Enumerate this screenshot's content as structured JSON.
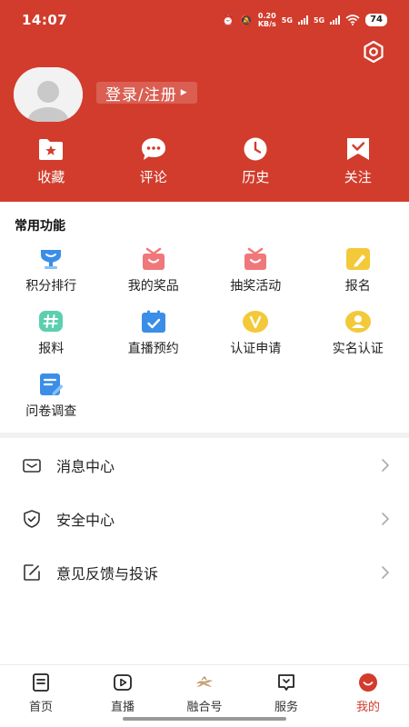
{
  "status_bar": {
    "time": "14:07",
    "net_speed_value": "0.20",
    "net_speed_unit": "KB/s",
    "signal1_label": "5G",
    "signal2_label": "5G",
    "battery": "74"
  },
  "header": {
    "login_label": "登录/注册",
    "quick_links": [
      {
        "label": "收藏",
        "icon": "folder-star-icon"
      },
      {
        "label": "评论",
        "icon": "comment-icon"
      },
      {
        "label": "历史",
        "icon": "clock-icon"
      },
      {
        "label": "关注",
        "icon": "bookmark-icon"
      }
    ]
  },
  "features": {
    "title": "常用功能",
    "items": [
      {
        "label": "积分排行",
        "icon": "trophy-icon"
      },
      {
        "label": "我的奖品",
        "icon": "gift-icon"
      },
      {
        "label": "抽奖活动",
        "icon": "gift-icon"
      },
      {
        "label": "报名",
        "icon": "pencil-note-icon"
      },
      {
        "label": "报料",
        "icon": "hashtag-icon"
      },
      {
        "label": "直播预约",
        "icon": "calendar-check-icon"
      },
      {
        "label": "认证申请",
        "icon": "badge-v-icon"
      },
      {
        "label": "实名认证",
        "icon": "user-badge-icon"
      },
      {
        "label": "问卷调查",
        "icon": "survey-icon"
      }
    ]
  },
  "menu": {
    "items": [
      {
        "label": "消息中心",
        "icon": "mail-icon"
      },
      {
        "label": "安全中心",
        "icon": "shield-icon"
      },
      {
        "label": "意见反馈与投诉",
        "icon": "edit-icon"
      }
    ]
  },
  "bottom_nav": {
    "items": [
      {
        "label": "首页",
        "icon": "news-icon"
      },
      {
        "label": "直播",
        "icon": "play-icon"
      },
      {
        "label": "融合号",
        "icon": "logo-icon"
      },
      {
        "label": "服务",
        "icon": "service-icon"
      },
      {
        "label": "我的",
        "icon": "profile-smile-icon"
      }
    ],
    "active_index": 4
  },
  "colors": {
    "brand_red": "#d23c2c",
    "icon_blue": "#3b8ee8",
    "icon_pink": "#f0787a",
    "icon_yellow": "#f3c93a",
    "icon_teal": "#5ccfb0"
  }
}
